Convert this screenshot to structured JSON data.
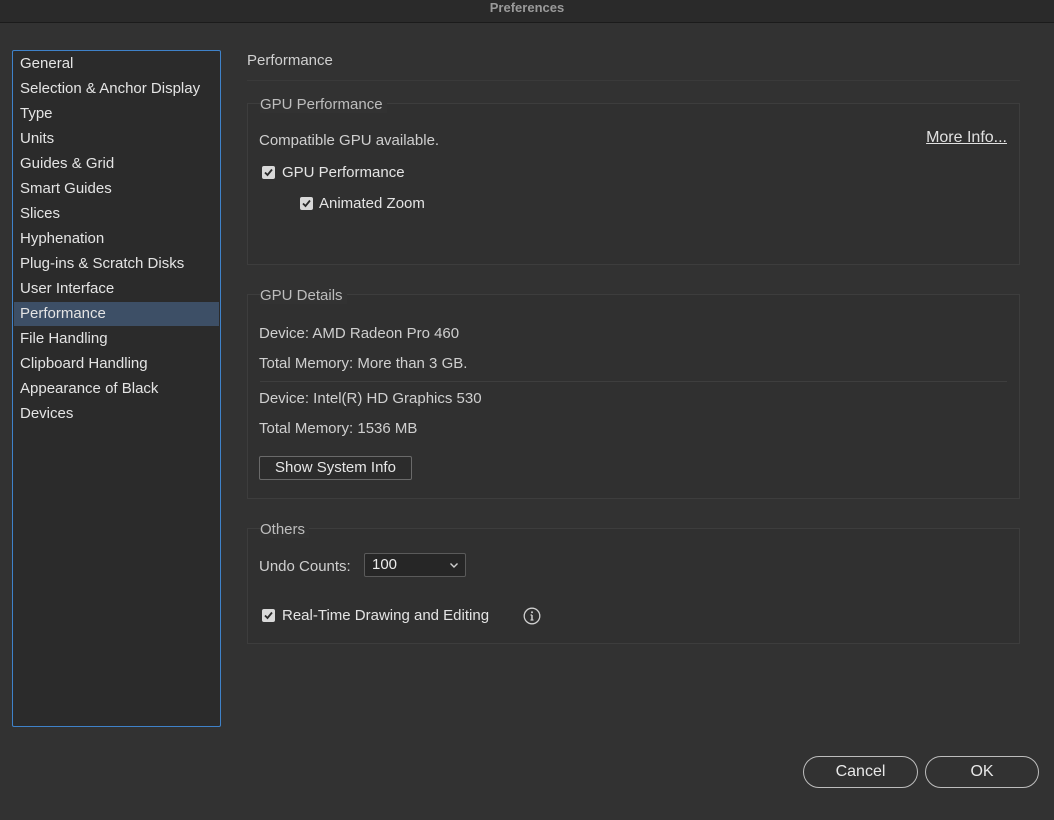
{
  "window": {
    "title": "Preferences"
  },
  "sidebar": {
    "items": [
      {
        "label": "General"
      },
      {
        "label": "Selection & Anchor Display"
      },
      {
        "label": "Type"
      },
      {
        "label": "Units"
      },
      {
        "label": "Guides & Grid"
      },
      {
        "label": "Smart Guides"
      },
      {
        "label": "Slices"
      },
      {
        "label": "Hyphenation"
      },
      {
        "label": "Plug-ins & Scratch Disks"
      },
      {
        "label": "User Interface"
      },
      {
        "label": "Performance",
        "selected": true
      },
      {
        "label": "File Handling"
      },
      {
        "label": "Clipboard Handling"
      },
      {
        "label": "Appearance of Black"
      },
      {
        "label": "Devices"
      }
    ]
  },
  "main": {
    "heading": "Performance",
    "gpu_performance": {
      "title": "GPU Performance",
      "status": "Compatible GPU available.",
      "more_info": "More Info...",
      "gpu_checkbox": {
        "label": "GPU Performance",
        "checked": true
      },
      "zoom_checkbox": {
        "label": "Animated Zoom",
        "checked": true
      }
    },
    "gpu_details": {
      "title": "GPU Details",
      "devices": [
        {
          "device": "Device: AMD Radeon Pro 460",
          "memory": "Total Memory:  More than 3 GB."
        },
        {
          "device": "Device: Intel(R) HD Graphics 530",
          "memory": "Total Memory: 1536 MB"
        }
      ],
      "system_info_button": "Show System Info"
    },
    "others": {
      "title": "Others",
      "undo_label": "Undo Counts:",
      "undo_value": "100",
      "realtime_checkbox": {
        "label": "Real-Time Drawing and Editing",
        "checked": true
      },
      "info_icon": "info-icon"
    }
  },
  "footer": {
    "cancel_label": "Cancel",
    "ok_label": "OK"
  },
  "colors": {
    "background": "#323232",
    "selection": "#3d4f66",
    "focus_border": "#3f82c9"
  }
}
